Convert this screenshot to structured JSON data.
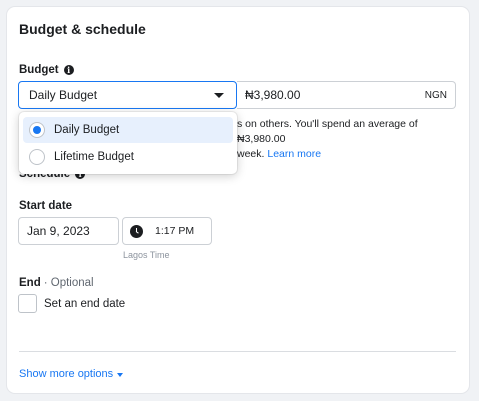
{
  "section_title": "Budget & schedule",
  "budget": {
    "label": "Budget",
    "selected": "Daily Budget",
    "amount": "₦3,980.00",
    "currency": "NGN"
  },
  "dropdown": {
    "options": [
      {
        "label": "Daily Budget",
        "selected": true
      },
      {
        "label": "Lifetime Budget",
        "selected": false
      }
    ]
  },
  "description": {
    "text": "s on others. You'll spend an average of ₦3,980.00",
    "text2": "week.",
    "link": "Learn more"
  },
  "schedule": {
    "label": "Schedule"
  },
  "start_date": {
    "label": "Start date",
    "date": "Jan 9, 2023",
    "time": "1:17 PM",
    "timezone": "Lagos Time"
  },
  "end": {
    "label": "End",
    "optional": "· Optional",
    "checkbox_label": "Set an end date"
  },
  "more_options": "Show more options",
  "colors": {
    "accent": "#1877f2",
    "selected_bg": "#e7f0fd"
  }
}
